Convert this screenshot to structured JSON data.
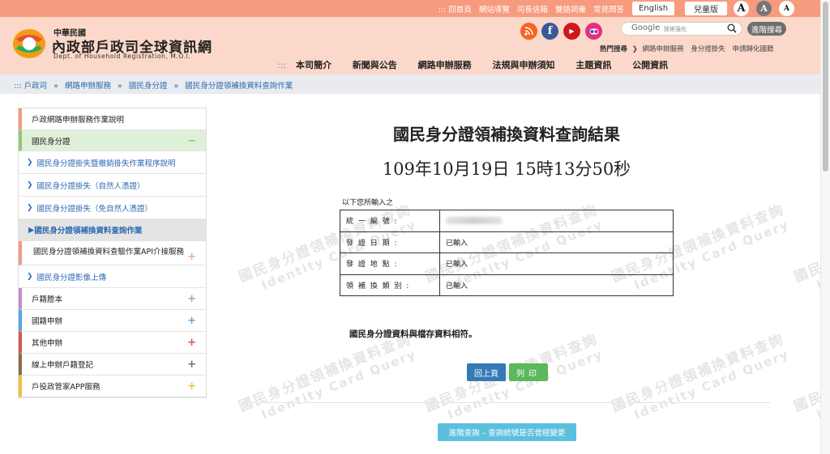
{
  "topbar": {
    "links": [
      "::: 回首頁",
      "網站導覽",
      "司長信箱",
      "雙語詞彙",
      "常見問答"
    ],
    "english_label": "English",
    "kids_label": "兒童版",
    "font_sizes": [
      "A",
      "A",
      "A"
    ]
  },
  "site": {
    "title_line1": "中華民國",
    "title_line2": "內政部戶政司全球資訊網",
    "title_line3": "Dept. of Household Registration, M.O.I.",
    "logo_text": "戶政"
  },
  "social": [
    {
      "icon": "rss-icon",
      "glyph": "◉",
      "color": "#f26522"
    },
    {
      "icon": "facebook-icon",
      "glyph": "f",
      "color": "#3b5998"
    },
    {
      "icon": "youtube-icon",
      "glyph": "▶",
      "color": "#cc181e"
    },
    {
      "icon": "flickr-icon",
      "glyph": "●●",
      "color": "#e0317f"
    }
  ],
  "search": {
    "google_label": "Google",
    "placeholder": "技術強化",
    "advanced_label": "進階搜尋"
  },
  "hot_search": {
    "label": "熱門搜尋",
    "items": [
      "網路申辦服務",
      "身分證掛失",
      "申請歸化國籍"
    ]
  },
  "main_nav": {
    "dots": ":::",
    "items": [
      "本司簡介",
      "新聞與公告",
      "網路申辦服務",
      "法規與申辦須知",
      "主題資訊",
      "公開資訊"
    ]
  },
  "breadcrumb": {
    "items": [
      "::: 戶政司",
      "網路申辦服務",
      "國民身分證",
      "國民身分證領補換資料查詢作業"
    ]
  },
  "sidebar": {
    "items": [
      {
        "label": "戶政網路申辦服務作業說明",
        "kind": "top"
      },
      {
        "label": "國民身分證",
        "kind": "sec",
        "sign": "−",
        "sign_color": "#8dc87f"
      },
      {
        "label": "國民身分證掛失暨撤銷掛失作業程序說明",
        "kind": "sub"
      },
      {
        "label": "國民身分證掛失（自然人憑證）",
        "kind": "sub"
      },
      {
        "label": "國民身分證掛失（免自然人憑證）",
        "kind": "sub"
      },
      {
        "label": "國民身分證領補換資料查詢作業",
        "kind": "cur"
      },
      {
        "label": "國民身分證領補換資料查驗作業API介接服務",
        "kind": "child",
        "sign": "+",
        "sign_color": "#f5a87a"
      },
      {
        "label": "國民身分證影像上傳",
        "kind": "sub"
      },
      {
        "label": "戶籍謄本",
        "kind": "cat",
        "sign": "+",
        "sign_color": "#c38dc7",
        "bar": "#c38dc7"
      },
      {
        "label": "國籍申辦",
        "kind": "cat",
        "sign": "+",
        "sign_color": "#5aa4e0",
        "bar": "#5aa4e0"
      },
      {
        "label": "其他申辦",
        "kind": "cat",
        "sign": "+",
        "sign_color": "#d9534f",
        "bar": "#d9534f"
      },
      {
        "label": "線上申辦戶籍登記",
        "kind": "cat",
        "sign": "+",
        "sign_color": "#8b6b4a",
        "bar": "#8b6b4a"
      },
      {
        "label": "戶役政管家APP服務",
        "kind": "cat",
        "sign": "+",
        "sign_color": "#f0c040",
        "bar": "#f0c040"
      }
    ]
  },
  "main": {
    "title": "國民身分證領補換資料查詢結果",
    "timestamp": "109年10月19日 15時13分50秒",
    "intro": "以下您所輸入之",
    "rows": [
      {
        "key": "統 一 編 號 :",
        "value": ""
      },
      {
        "key": "發 證 日 期 :",
        "value": "已輸入"
      },
      {
        "key": "發 證 地 點 :",
        "value": "已輸入"
      },
      {
        "key": "領 補 換 類 別 :",
        "value": "已輸入"
      }
    ],
    "result": "國民身分證資料與檔存資料相符。",
    "back_label": "回上頁",
    "print_label": "列印",
    "advanced_query_label": "進階查詢 – 查詢統號是否曾經變更"
  },
  "watermark": {
    "cn": "國民身分證領補換資料查詢",
    "en": "Identity Card Query"
  }
}
